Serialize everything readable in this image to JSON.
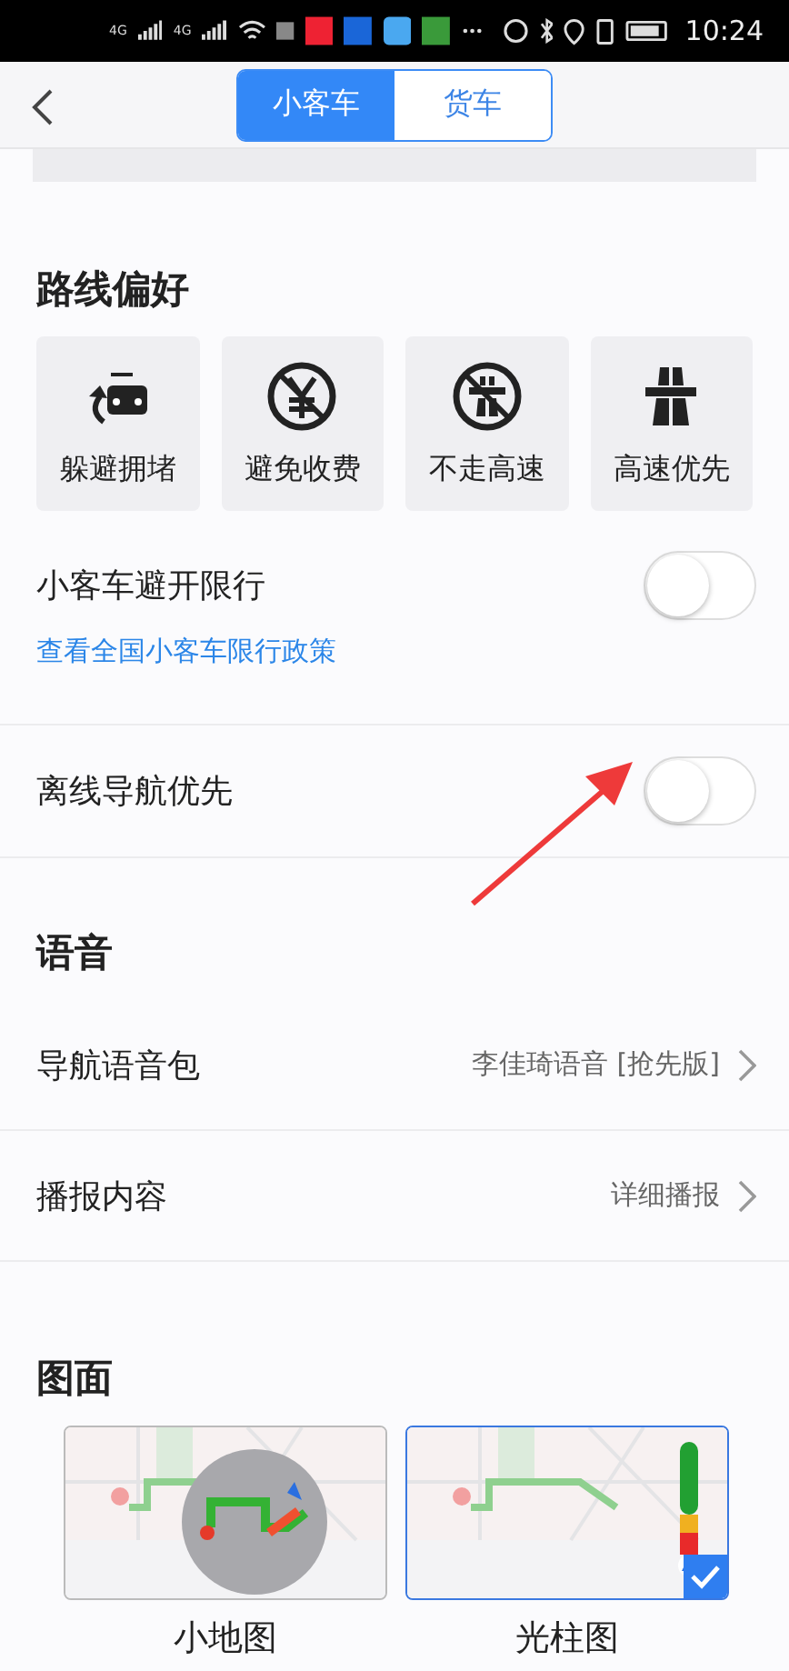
{
  "status_bar": {
    "signals": [
      {
        "label": "4G"
      },
      {
        "label": "4G"
      }
    ],
    "time": "10:24"
  },
  "header": {
    "tabs": [
      {
        "label": "小客车",
        "selected": true
      },
      {
        "label": "货车",
        "selected": false
      }
    ]
  },
  "route_preference": {
    "title": "路线偏好",
    "options": [
      {
        "label": "躲避拥堵",
        "kind": "congestion",
        "selected": false
      },
      {
        "label": "避免收费",
        "kind": "toll",
        "selected": false
      },
      {
        "label": "不走高速",
        "kind": "nohighway",
        "selected": false
      },
      {
        "label": "高速优先",
        "kind": "highway",
        "selected": false
      }
    ],
    "rows": [
      {
        "label": "小客车避开限行",
        "on": false,
        "link": "查看全国小客车限行政策"
      },
      {
        "label": "离线导航优先",
        "on": false
      }
    ]
  },
  "voice": {
    "title": "语音",
    "rows": [
      {
        "label": "导航语音包",
        "value": "李佳琦语音 [抢先版]"
      },
      {
        "label": "播报内容",
        "value": "详细播报"
      }
    ]
  },
  "display": {
    "title": "图面",
    "options": [
      {
        "label": "小地图",
        "kind": "minimap",
        "selected": false
      },
      {
        "label": "光柱图",
        "kind": "lightbar",
        "selected": true
      }
    ]
  }
}
